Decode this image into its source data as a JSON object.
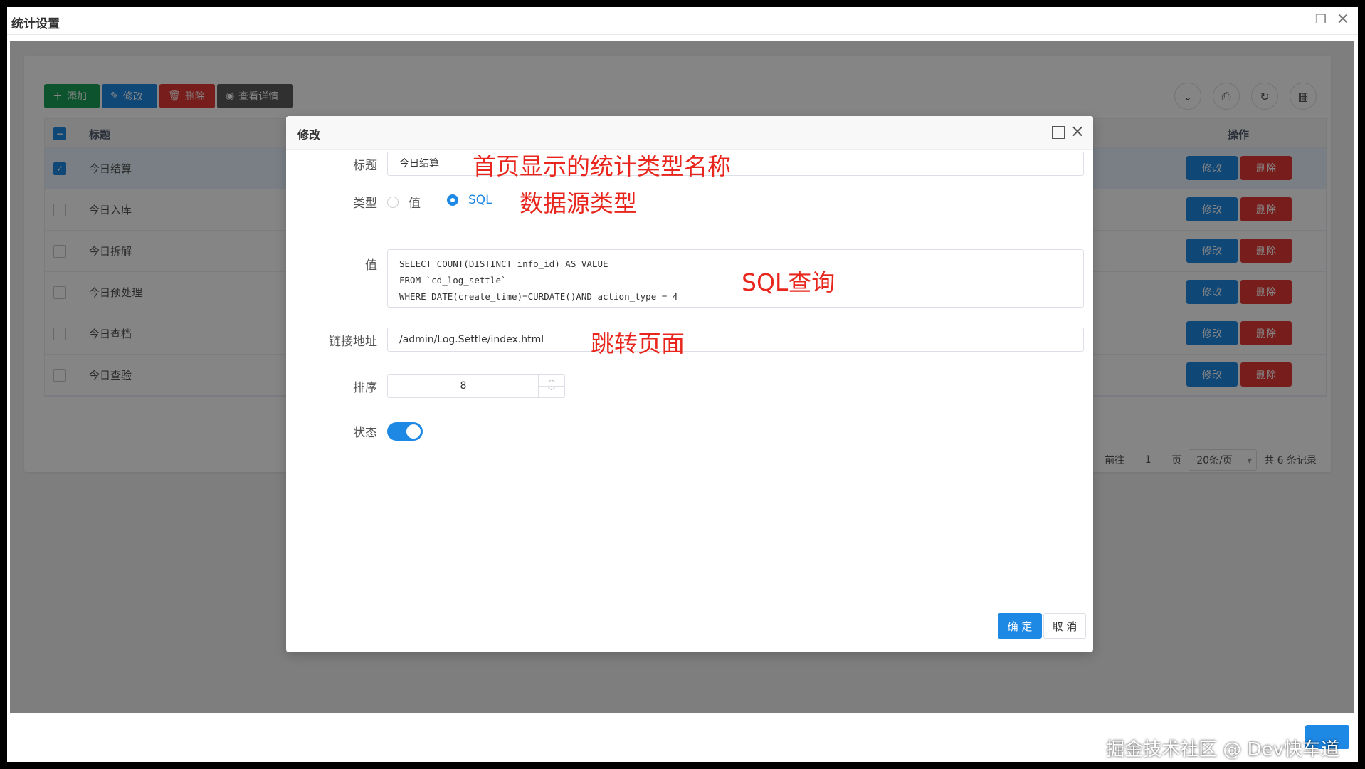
{
  "window": {
    "title": "统计设置"
  },
  "toolbar": {
    "add": "添加",
    "edit": "修改",
    "delete": "删除",
    "view": "查看详情"
  },
  "table": {
    "headers": {
      "title": "标题",
      "ops": "操作"
    },
    "rows": [
      {
        "title": "今日结算",
        "checked": true
      },
      {
        "title": "今日入库",
        "checked": false
      },
      {
        "title": "今日拆解",
        "checked": false
      },
      {
        "title": "今日预处理",
        "checked": false
      },
      {
        "title": "今日查档",
        "checked": false
      },
      {
        "title": "今日查验",
        "checked": false
      }
    ],
    "row_edit": "修改",
    "row_delete": "删除"
  },
  "pager": {
    "goto": "前往",
    "page": "1",
    "page_unit": "页",
    "size": "20条/页",
    "total": "共 6 条记录"
  },
  "modal": {
    "title": "修改",
    "fields": {
      "title_label": "标题",
      "title_value": "今日结算",
      "type_label": "类型",
      "type_option_value": "值",
      "type_option_sql": "SQL",
      "value_label": "值",
      "value_text": "SELECT COUNT(DISTINCT info_id) AS VALUE\nFROM `cd_log_settle`\nWHERE DATE(create_time)=CURDATE()AND action_type = 4",
      "link_label": "链接地址",
      "link_value": "/admin/Log.Settle/index.html",
      "sort_label": "排序",
      "sort_value": "8",
      "status_label": "状态"
    },
    "ok": "确 定",
    "cancel": "取 消"
  },
  "annotations": {
    "a1": "首页显示的统计类型名称",
    "a2": "数据源类型",
    "a3": "SQL查询",
    "a4": "跳转页面"
  },
  "watermark": "掘金技术社区 @ Dev快车道",
  "colors": {
    "primary": "#1e88e5",
    "danger": "#e53935",
    "success": "#18a058",
    "annotation": "#e8261d"
  }
}
